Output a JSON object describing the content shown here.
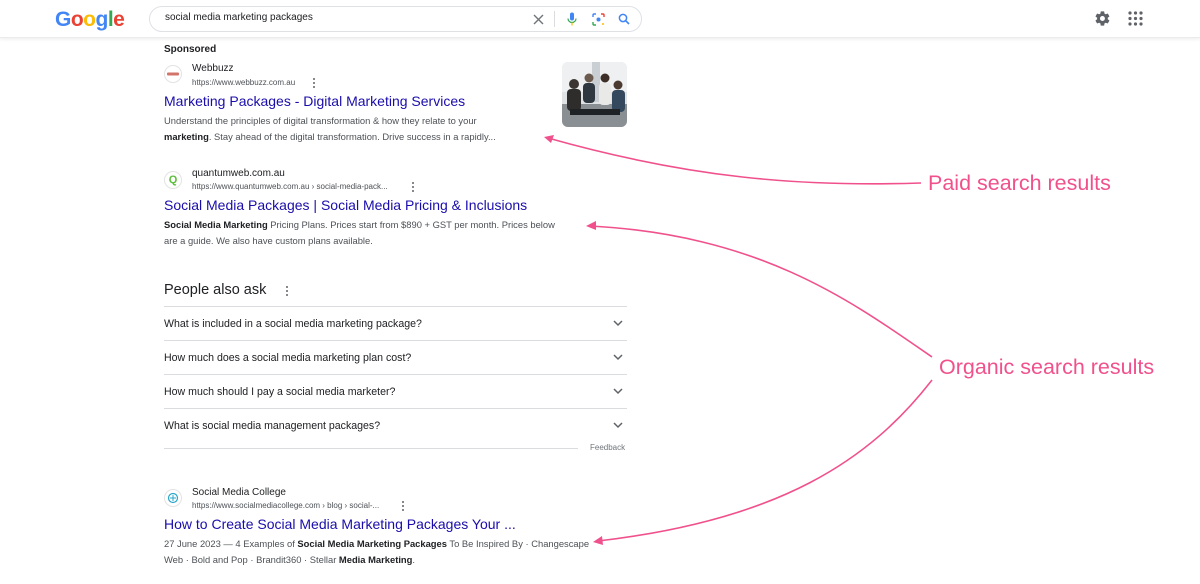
{
  "header": {
    "logo_letters": [
      "G",
      "o",
      "o",
      "g",
      "l",
      "e"
    ],
    "search_query": "social media marketing packages",
    "icons": [
      "clear-icon",
      "microphone-icon",
      "lens-icon",
      "search-icon",
      "settings-icon",
      "apps-icon"
    ]
  },
  "sponsored_label": "Sponsored",
  "ads": [
    {
      "site_name": "Webbuzz",
      "url": "https://www.webbuzz.com.au",
      "title": "Marketing Packages - Digital Marketing Services",
      "desc_line1": "Understand the principles of digital transformation & how they relate to your",
      "desc_line2_bold": "marketing",
      "desc_line2_rest": ". Stay ahead of the digital transformation. Drive success in a rapidly..."
    },
    {
      "site_name": "quantumweb.com.au",
      "url": "https://www.quantumweb.com.au › social-media-pack...",
      "favicon_letter": "Q",
      "title": "Social Media Packages | Social Media Pricing & Inclusions",
      "desc_line1_bold": "Social Media Marketing",
      "desc_line1_rest": " Pricing Plans. Prices start from $890 + GST per month. Prices below",
      "desc_line2": "are a guide. We also have custom plans available."
    }
  ],
  "people_also_ask": {
    "title": "People also ask",
    "questions": [
      "What is included in a social media marketing package?",
      "How much does a social media marketing plan cost?",
      "How much should I pay a social media marketer?",
      "What is social media management packages?"
    ],
    "feedback": "Feedback"
  },
  "organic": {
    "site_name": "Social Media College",
    "url": "https://www.socialmediacollege.com › blog › social-...",
    "title": "How to Create Social Media Marketing Packages Your ...",
    "desc_line1_pre": "27 June 2023 — 4 Examples of ",
    "desc_line1_bold": "Social Media Marketing Packages",
    "desc_line1_rest": " To Be Inspired By · Changescape",
    "desc_line2_pre": "Web · Bold and Pop · Brandit360 · Stellar ",
    "desc_line2_bold": "Media Marketing",
    "desc_line2_rest": "."
  },
  "annotations": {
    "paid": "Paid search results",
    "organic": "Organic search results",
    "color": "#f0518c"
  },
  "colors": {
    "link": "#1a0dab",
    "text": "#202124",
    "secondary": "#4d5156"
  }
}
